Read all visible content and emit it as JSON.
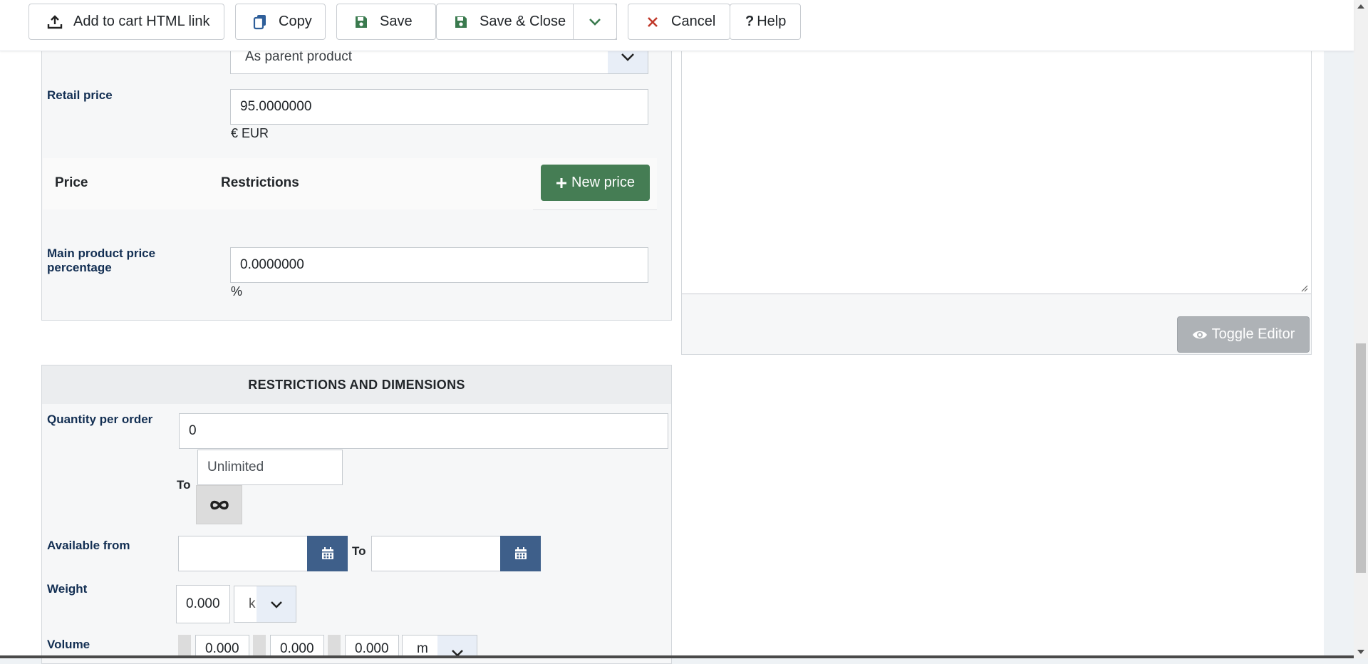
{
  "toolbar": {
    "add_to_cart": "Add to cart HTML link",
    "copy": "Copy",
    "save": "Save",
    "save_close": "Save & Close",
    "cancel": "Cancel",
    "help": "Help"
  },
  "pricing": {
    "select_value": "As parent product",
    "retail_price_label": "Retail price",
    "retail_price_value": "95.0000000",
    "currency": "€ EUR",
    "table_headers": [
      "Price",
      "Restrictions"
    ],
    "new_price_label": "New price",
    "main_pct_label": "Main product price percentage",
    "main_pct_value": "0.0000000",
    "pct_unit": "%"
  },
  "editor": {
    "toggle_label": "Toggle Editor"
  },
  "restrictions": {
    "title": "RESTRICTIONS AND DIMENSIONS",
    "qty_label": "Quantity per order",
    "qty_value": "0",
    "to_label": "To",
    "unlimited_placeholder": "Unlimited",
    "available_from_label": "Available from",
    "available_to_label": "To",
    "available_from_value": "",
    "available_to_value": "",
    "weight_label": "Weight",
    "weight_value": "0.000",
    "weight_unit": "k",
    "volume_label": "Volume",
    "volume_values": [
      "0.000",
      "0.000",
      "0.000"
    ],
    "volume_unit": "m"
  },
  "colors": {
    "accent_green": "#457d54",
    "accent_blue": "#3e5f8a",
    "label_color": "#132f53",
    "cancel_red": "#c0392b"
  },
  "icons": {
    "add_to_cart": "upload-icon",
    "copy": "copy-icon",
    "save": "floppy-disk-icon",
    "cancel": "times-icon",
    "help": "question-icon",
    "new_price": "plus-icon",
    "toggle": "eye-icon",
    "calendar": "calendar-icon",
    "unlimited": "infinity-icon"
  }
}
